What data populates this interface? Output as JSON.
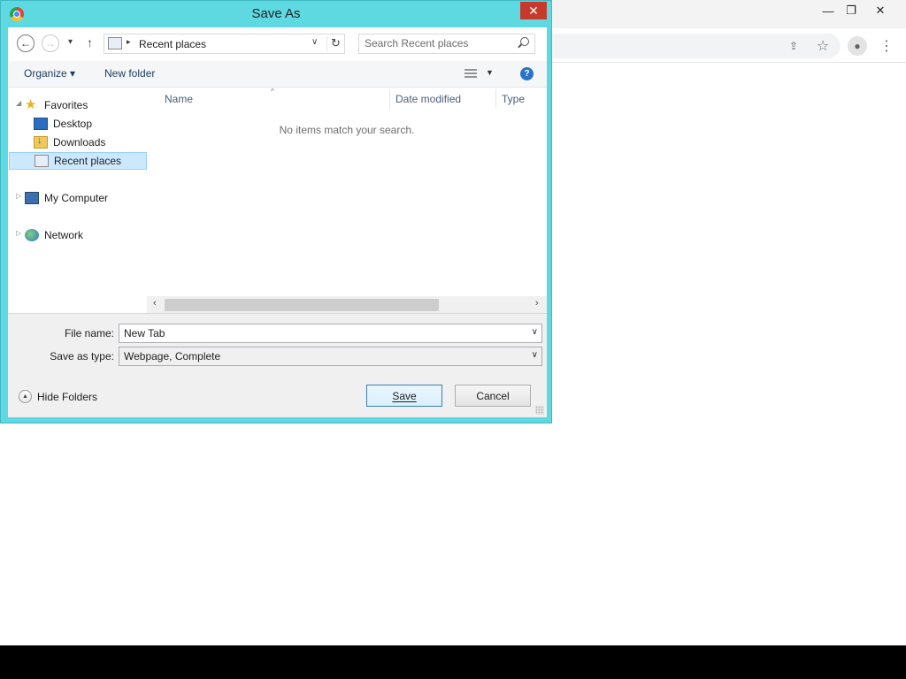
{
  "browser": {
    "minimize_glyph": "—",
    "restore_glyph": "❐",
    "close_glyph": "✕",
    "share_glyph": "⇪",
    "bookmark_glyph": "☆",
    "profile_glyph": "●",
    "menu_glyph": "⋮"
  },
  "dialog": {
    "title": "Save As",
    "close_glyph": "✕",
    "nav": {
      "back_glyph": "←",
      "forward_glyph": "→",
      "recent_dropdown_glyph": "▾",
      "up_glyph": "↑",
      "address_separator": "▸",
      "address_text": "Recent places",
      "address_dropdown_glyph": "∨",
      "refresh_glyph": "↻",
      "search_placeholder": "Search Recent places"
    },
    "toolbar": {
      "organize_label": "Organize ▾",
      "new_folder_label": "New folder",
      "view_dropdown_glyph": "▼",
      "help_glyph": "?"
    },
    "navigation_pane": {
      "favorites": "Favorites",
      "items": [
        "Desktop",
        "Downloads",
        "Recent places"
      ],
      "my_computer": "My Computer",
      "network": "Network",
      "expanded_glyph": "◢",
      "collapsed_glyph": "▷"
    },
    "file_list": {
      "columns": [
        "Name",
        "Date modified",
        "Type"
      ],
      "sort_glyph": "^",
      "empty_message": "No items match your search."
    },
    "scrollbar": {
      "left_glyph": "‹",
      "right_glyph": "›"
    },
    "fields": {
      "file_name_label": "File name:",
      "file_name_value": "New Tab",
      "save_type_label": "Save as type:",
      "save_type_value": "Webpage, Complete",
      "dropdown_glyph": "∨"
    },
    "footer": {
      "hide_folders_glyph": "▲",
      "hide_folders_label": "Hide Folders",
      "save_label": "Save",
      "cancel_label": "Cancel"
    }
  }
}
